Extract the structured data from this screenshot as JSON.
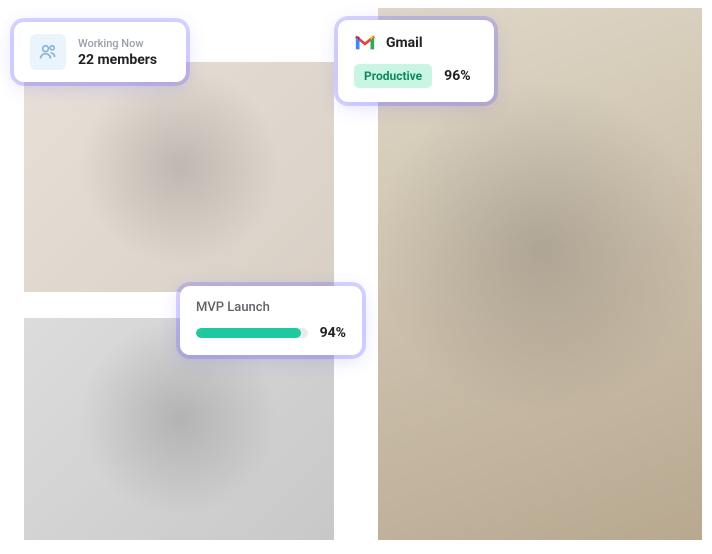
{
  "working_card": {
    "label": "Working Now",
    "value": "22 members",
    "icon": "people-icon"
  },
  "gmail_card": {
    "app_name": "Gmail",
    "badge": "Productive",
    "percent": "96%",
    "icon": "gmail-icon"
  },
  "mvp_card": {
    "title": "MVP Launch",
    "percent": "94%",
    "progress_width": "94%"
  },
  "colors": {
    "accent_purple": "#635bff",
    "teal": "#1fc9a0",
    "badge_bg": "#c9f5e3",
    "badge_text": "#0d8a5a"
  }
}
